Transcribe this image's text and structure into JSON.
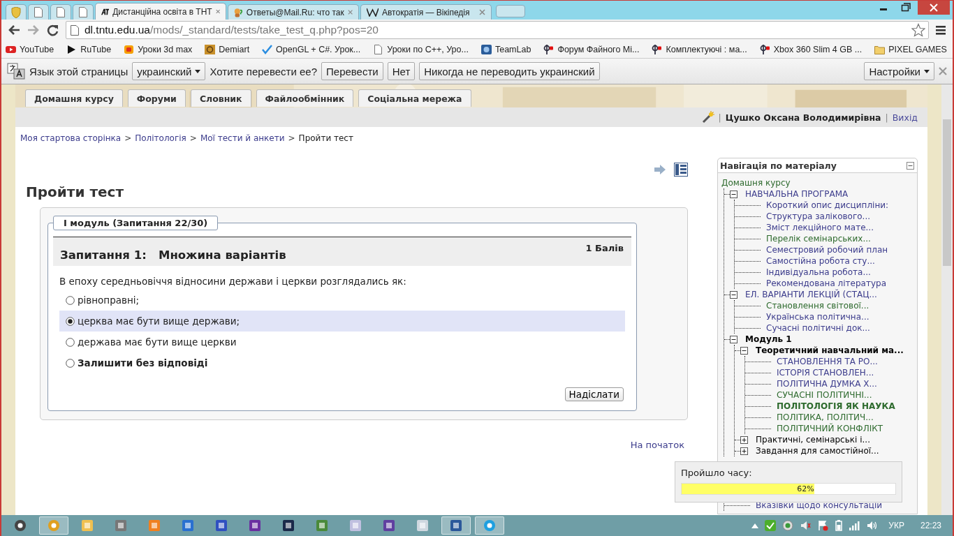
{
  "browser": {
    "tabs": [
      {
        "kind": "shield",
        "selected": false
      },
      {
        "kind": "page",
        "selected": false
      },
      {
        "kind": "page",
        "selected": false
      },
      {
        "kind": "page",
        "selected": false
      },
      {
        "kind": "site",
        "title": "Дистанційна освіта в ТНТ",
        "selected": true
      },
      {
        "kind": "answers",
        "title": "Ответы@Mail.Ru: что так",
        "selected": false
      },
      {
        "kind": "wiki",
        "title": "Автократія — Вікіпедія",
        "selected": false
      }
    ],
    "address": {
      "host": "dl.tntu.edu.ua",
      "path": "/mods/_standard/tests/take_test_q.php?pos=20"
    },
    "bookmarks": [
      {
        "label": "YouTube",
        "kind": "youtube"
      },
      {
        "label": "RuTube",
        "kind": "play"
      },
      {
        "label": "Уроки 3d max",
        "kind": "cube"
      },
      {
        "label": "Demiart",
        "kind": "pattern"
      },
      {
        "label": "OpenGL + C#. Урок...",
        "kind": "check"
      },
      {
        "label": "Уроки по C++, Уро...",
        "kind": "page"
      },
      {
        "label": "TeamLab",
        "kind": "teamlab"
      },
      {
        "label": "Форум Файного Мі...",
        "kind": "forum"
      },
      {
        "label": "Комплектуючі : ма...",
        "kind": "forum"
      },
      {
        "label": "Xbox 360 Slim 4 GB ...",
        "kind": "forum"
      },
      {
        "label": "PIXEL GAMES",
        "kind": "folder"
      }
    ],
    "translate_bar": {
      "label": "Язык этой страницы",
      "language": "украинский",
      "question": "Хотите перевести ее?",
      "buttons": [
        "Перевести",
        "Нет",
        "Никогда не переводить украинский"
      ],
      "settings": "Настройки"
    }
  },
  "site": {
    "tabs": [
      "Домашня курсу",
      "Форуми",
      "Словник",
      "Файлообмінник",
      "Соціальна мережа"
    ],
    "user_bar": [
      {
        "kind": "separator",
        "text": "|"
      },
      {
        "kind": "user",
        "text": "Цушко Оксана Володимирівна"
      },
      {
        "kind": "separator",
        "text": "|"
      },
      {
        "kind": "logout",
        "text": "Вихід"
      }
    ],
    "breadcrumb": [
      {
        "label": "Моя стартова сторінка",
        "kind": "link"
      },
      {
        "label": ">",
        "kind": "separator"
      },
      {
        "label": "Політологія",
        "kind": "link"
      },
      {
        "label": ">",
        "kind": "separator"
      },
      {
        "label": "Мої тести й анкети",
        "kind": "link"
      },
      {
        "label": ">",
        "kind": "separator"
      },
      {
        "label": "Пройти тест",
        "kind": "current"
      }
    ],
    "page_title": "Пройти тест",
    "test": {
      "legend": "I модуль (Запитання 22/30)",
      "question_label": "Запитання 1:",
      "question_type": "Множина варіантів",
      "points": "1 Балів",
      "text": "В епоху середньовіччя відносини держави і церкви розглядались як:",
      "options": [
        {
          "label": "рівноправні;",
          "kind": "answer",
          "selected": false
        },
        {
          "label": "церква має бути вище держави;",
          "kind": "answer",
          "selected": true
        },
        {
          "label": "держава має бути вище церкви",
          "kind": "answer",
          "selected": false
        },
        {
          "label": "Залишити без відповіді",
          "kind": "no_answer",
          "selected": false
        }
      ],
      "submit": "Надіслати"
    },
    "to_top": "На початок",
    "navigation": {
      "title": "Навігація по матеріалу",
      "home": "Домашня курсу",
      "tree": [
        {
          "label": "НАВЧАЛЬНА ПРОГРАМА",
          "kind": "link",
          "visited": false,
          "selected": false,
          "expanded": true,
          "children": [
            {
              "label": "Короткий опис дисципліни:",
              "kind": "link",
              "visited": false,
              "selected": false
            },
            {
              "label": "Структура залікового...",
              "kind": "link",
              "visited": false,
              "selected": false
            },
            {
              "label": "Зміст лекційного мате...",
              "kind": "link",
              "visited": false,
              "selected": false
            },
            {
              "label": "Перелік семінарських...",
              "kind": "link",
              "visited": true,
              "selected": false
            },
            {
              "label": "Семестровий робочий план",
              "kind": "link",
              "visited": false,
              "selected": false
            },
            {
              "label": "Самостійна робота сту...",
              "kind": "link",
              "visited": false,
              "selected": false
            },
            {
              "label": "Індивідуальна робота...",
              "kind": "link",
              "visited": false,
              "selected": false
            },
            {
              "label": "Рекомендована література",
              "kind": "link",
              "visited": false,
              "selected": false
            }
          ]
        },
        {
          "label": "ЕЛ. ВАРІАНТИ ЛЕКЦІЙ (СТАЦ...",
          "kind": "link",
          "visited": false,
          "selected": false,
          "expanded": true,
          "children": [
            {
              "label": "Становлення світової...",
              "kind": "link",
              "visited": true,
              "selected": false
            },
            {
              "label": "Українська політична...",
              "kind": "link",
              "visited": false,
              "selected": false
            },
            {
              "label": "Сучасні політичні док...",
              "kind": "link",
              "visited": false,
              "selected": false
            }
          ]
        },
        {
          "label": "Модуль 1",
          "kind": "heading",
          "selected": false,
          "expanded": true,
          "children": [
            {
              "label": "Теоретичний навчальний ма...",
              "kind": "heading",
              "selected": false,
              "expanded": true,
              "children": [
                {
                  "label": "СТАНОВЛЕННЯ ТА РО...",
                  "kind": "link",
                  "visited": false,
                  "selected": false
                },
                {
                  "label": "ІСТОРІЯ СТАНОВЛЕН...",
                  "kind": "link",
                  "visited": false,
                  "selected": false
                },
                {
                  "label": "ПОЛІТИЧНА ДУМКА Х...",
                  "kind": "link",
                  "visited": false,
                  "selected": false
                },
                {
                  "label": "СУЧАСНІ ПОЛІТИЧНІ...",
                  "kind": "link",
                  "visited": true,
                  "selected": false
                },
                {
                  "label": "ПОЛІТОЛОГІЯ ЯК НАУКА",
                  "kind": "link",
                  "visited": true,
                  "selected": true
                },
                {
                  "label": "ПОЛІТИКА, ПОЛІТИЧ...",
                  "kind": "link",
                  "visited": true,
                  "selected": false
                },
                {
                  "label": "ПОЛІТИЧНИЙ КОНФЛІКТ",
                  "kind": "link",
                  "visited": true,
                  "selected": false
                }
              ]
            },
            {
              "label": "Практичні, семінарські і...",
              "kind": "section",
              "selected": false,
              "expanded": false
            },
            {
              "label": "Завдання для самостійної...",
              "kind": "section",
              "selected": false,
              "expanded": false
            }
          ]
        }
      ],
      "timer": {
        "label": "Пройшло часу:",
        "level": 0.62,
        "reading": "62%"
      },
      "tree_continued": [
        {
          "label": "Вказівки щодо консультацій",
          "kind": "link",
          "visited": false,
          "selected": false
        }
      ]
    }
  },
  "taskbar": {
    "apps": [
      {
        "kind": "start",
        "open": false
      },
      {
        "kind": "chrome",
        "open": true
      },
      {
        "kind": "explorer",
        "open": false
      },
      {
        "kind": "media",
        "open": false
      },
      {
        "kind": "player",
        "open": false
      },
      {
        "kind": "flash",
        "open": false
      },
      {
        "kind": "loop",
        "open": false
      },
      {
        "kind": "vs",
        "open": false
      },
      {
        "kind": "ps",
        "open": false
      },
      {
        "kind": "sheet",
        "open": false
      },
      {
        "kind": "paint",
        "open": false
      },
      {
        "kind": "archive",
        "open": false
      },
      {
        "kind": "calc",
        "open": false
      },
      {
        "kind": "word",
        "open": true
      },
      {
        "kind": "skype",
        "open": true
      }
    ],
    "language": "УКР",
    "time": "22:23"
  }
}
